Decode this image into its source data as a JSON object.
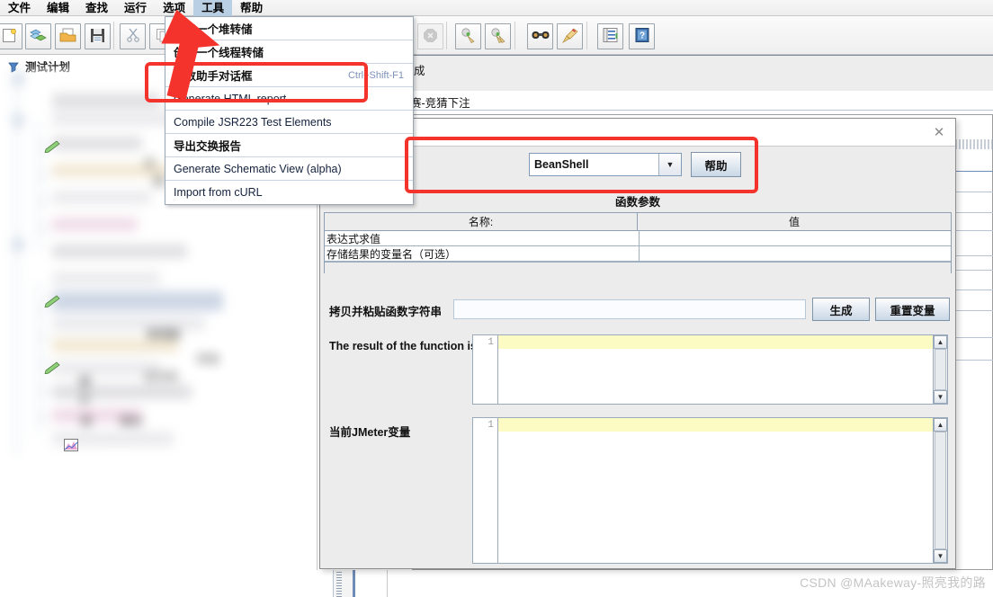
{
  "app": {
    "menubar": [
      {
        "label": "文件",
        "name": "menu-file",
        "active": false
      },
      {
        "label": "编辑",
        "name": "menu-edit",
        "active": false
      },
      {
        "label": "查找",
        "name": "menu-find",
        "active": false
      },
      {
        "label": "运行",
        "name": "menu-run",
        "active": false
      },
      {
        "label": "选项",
        "name": "menu-options",
        "active": false
      },
      {
        "label": "工具",
        "name": "menu-tools",
        "active": true
      },
      {
        "label": "帮助",
        "name": "menu-help",
        "active": false
      }
    ],
    "toolbar": {
      "items": [
        {
          "name": "new-test-plan-icon",
          "glyph": "🗋"
        },
        {
          "name": "templates-icon",
          "glyph": "📚"
        },
        {
          "name": "open-icon",
          "glyph": "📂"
        },
        {
          "name": "save-icon",
          "glyph": "💾"
        },
        {
          "name": "cut-icon",
          "glyph": "✂"
        },
        {
          "name": "copy-icon",
          "glyph": "🗐"
        },
        {
          "name": "paste-icon",
          "glyph": "📋"
        },
        {
          "name": "expand-icon",
          "glyph": "⊞"
        },
        {
          "name": "collapse-icon",
          "glyph": "⊟"
        },
        {
          "name": "toggle-icon",
          "glyph": "⏻"
        },
        {
          "name": "start-icon",
          "glyph": "▶"
        },
        {
          "name": "start-no-pause-icon",
          "glyph": "⏩"
        },
        {
          "name": "stop-icon",
          "glyph": "⛔"
        },
        {
          "name": "shutdown-icon",
          "glyph": "✖"
        },
        {
          "name": "clear-icon",
          "glyph": "🧹"
        },
        {
          "name": "clear-all-icon",
          "glyph": "🧹"
        },
        {
          "name": "search-icon",
          "glyph": "🔍"
        },
        {
          "name": "reset-search-icon",
          "glyph": "🧽"
        },
        {
          "name": "function-helper-icon",
          "glyph": "📑"
        },
        {
          "name": "help-icon",
          "glyph": "❓"
        }
      ]
    }
  },
  "tree": {
    "root_label": "测试计划",
    "ghost_labels": [
      {
        "text": "管理器"
      },
      {
        "text": "市场"
      },
      {
        "text": "主方向"
      },
      {
        "text": "果树"
      },
      {
        "text": "值"
      },
      {
        "text": "察"
      }
    ]
  },
  "tools_menu": {
    "name": "tools-dropdown-menu",
    "items": [
      {
        "label": "创建一个堆转储",
        "accelerator": "",
        "cn": true,
        "highlighted": false
      },
      {
        "label": "创建一个线程转储",
        "accelerator": "",
        "cn": true,
        "highlighted": false
      },
      {
        "label": "函数助手对话框",
        "accelerator": "Ctrl+Shift-F1",
        "cn": true,
        "highlighted": true
      },
      {
        "label": "Generate HTML report",
        "accelerator": "",
        "cn": false,
        "highlighted": false
      },
      {
        "label": "Compile JSR223 Test Elements",
        "accelerator": "",
        "cn": false,
        "highlighted": false
      },
      {
        "label": "导出交换报告",
        "accelerator": "",
        "cn": true,
        "highlighted": false
      },
      {
        "label": "Generate Schematic View (alpha)",
        "accelerator": "",
        "cn": false,
        "highlighted": false
      },
      {
        "label": "Import from cURL",
        "accelerator": "",
        "cn": false,
        "highlighted": false
      }
    ]
  },
  "dialog": {
    "name": "function-helper-dialog",
    "close_glyph": "✕",
    "function_select": {
      "value": "BeanShell",
      "arrow_glyph": "▼"
    },
    "help_button": "帮助",
    "params_title": "函数参数",
    "params_table": {
      "headers": [
        "名称:",
        "值"
      ],
      "rows": [
        {
          "name": "表达式求值",
          "value": ""
        },
        {
          "name": "存储结果的变量名（可选）",
          "value": ""
        }
      ]
    },
    "copy_paste_label": "拷贝并粘贴函数字符串",
    "copy_paste_value": "",
    "generate_button": "生成",
    "reset_button": "重置变量",
    "result_label": "The result of the function is",
    "result_value": "",
    "result_line_number": "1",
    "variables_label": "当前JMeter变量",
    "variables_value": "",
    "variables_line_number": "1",
    "scroll_up_glyph": "▲",
    "scroll_down_glyph": "▼"
  },
  "background": {
    "partial_text_1": "成",
    "partial_text_2": "赛-竞猜下注"
  },
  "annotations": {
    "highlight_color": "#f4342c",
    "arrow_color": "#f4342c",
    "boxes": [
      {
        "name": "highlight-menu-item-function-helper"
      },
      {
        "name": "highlight-function-select-row"
      }
    ],
    "arrow": {
      "name": "pointer-arrow-to-tools-menu"
    }
  },
  "watermark": {
    "text": "CSDN @MAakeway-照亮我的路"
  }
}
